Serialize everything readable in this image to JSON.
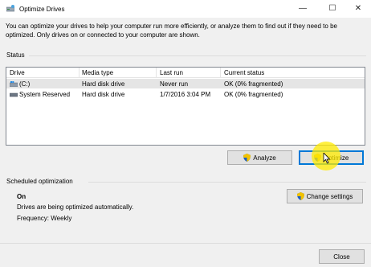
{
  "window": {
    "title": "Optimize Drives",
    "minimize": "—",
    "maximize": "☐",
    "close": "✕"
  },
  "intro": "You can optimize your drives to help your computer run more efficiently, or analyze them to find out if they need to be optimized. Only drives on or connected to your computer are shown.",
  "status": {
    "label": "Status",
    "columns": [
      "Drive",
      "Media type",
      "Last run",
      "Current status"
    ],
    "rows": [
      {
        "drive": "(C:)",
        "media": "Hard disk drive",
        "last_run": "Never run",
        "status": "OK (0% fragmented)",
        "icon": "windows-drive-icon",
        "selected": true
      },
      {
        "drive": "System Reserved",
        "media": "Hard disk drive",
        "last_run": "1/7/2016 3:04 PM",
        "status": "OK (0% fragmented)",
        "icon": "drive-icon",
        "selected": false
      }
    ]
  },
  "actions": {
    "analyze": "Analyze",
    "optimize": "Optimize"
  },
  "scheduled": {
    "label": "Scheduled optimization",
    "state": "On",
    "description": "Drives are being optimized automatically.",
    "frequency": "Frequency: Weekly",
    "change_settings": "Change settings"
  },
  "footer": {
    "close": "Close"
  },
  "colors": {
    "accent": "#0078d7",
    "highlight": "#ffeb00",
    "selected_row": "#e5e5e5"
  }
}
